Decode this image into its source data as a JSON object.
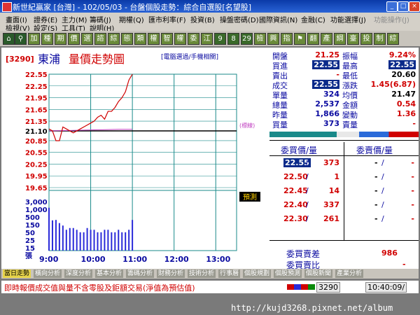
{
  "window": {
    "title": "新世紀贏家 [台灣] - 102/05/03 - 台盤個股走勢：綜合自選股[名望股]"
  },
  "menu": [
    "畫面(I)",
    "證券(E)",
    "主力(M)",
    "籌碼(J)",
    "期權(Q)",
    "匯市利率(F)",
    "投資(B)",
    "操盤密碼(D)",
    "國際資訊(N)",
    "金融(C)",
    "功能選擇(J)",
    "功能操作(J)",
    "檢視(V)",
    "設定(S)",
    "工具(T)",
    "說明(H)"
  ],
  "toolbar": [
    "加",
    "種",
    "期",
    "價",
    "選",
    "諮",
    "綜",
    "態",
    "類",
    "權",
    "智",
    "權",
    "委",
    "江",
    "9",
    "8",
    "29",
    "檢",
    "興",
    "指",
    "⚑",
    "翻",
    "產",
    "綱",
    "臺",
    "投",
    "制",
    "綜"
  ],
  "chart": {
    "code": "[3290]",
    "name": "東浦",
    "title": "量價走勢圖",
    "subtitle": "[電腦選過/手機相關]",
    "y_labels": [
      "22.55",
      "22.25",
      "21.95",
      "21.65",
      "21.35",
      "21.10",
      "20.85",
      "20.55",
      "20.25",
      "19.95",
      "19.65"
    ],
    "ref_price": "21.10",
    "ref_note": "(標線)",
    "vol_labels": [
      "3,000",
      "1,000",
      "500",
      "150",
      "50",
      "25",
      "15",
      "張"
    ],
    "x_labels": [
      "9:00",
      "10:00",
      "11:00",
      "12:00",
      "13:00"
    ],
    "predict_label": "預測"
  },
  "chart_data": {
    "type": "line",
    "title": "量價走勢圖",
    "x_unit": "time",
    "x": [
      "09:00",
      "09:05",
      "09:10",
      "09:15",
      "09:20",
      "09:25",
      "09:30",
      "09:35",
      "09:40",
      "09:45",
      "09:50",
      "09:55",
      "10:00",
      "10:05",
      "10:10",
      "10:15",
      "10:20",
      "10:25",
      "10:30",
      "10:35",
      "10:40",
      "10:45",
      "10:50",
      "10:55",
      "11:00"
    ],
    "series": [
      {
        "values": [
          21.15,
          21.1,
          20.85,
          20.85,
          21.2,
          21.15,
          21.1,
          21.05,
          21.1,
          21.15,
          21.2,
          21.25,
          21.3,
          21.35,
          21.45,
          21.5,
          21.4,
          21.6,
          21.6,
          21.7,
          21.85,
          21.95,
          22.1,
          22.4,
          22.55
        ]
      }
    ],
    "volume": [
      1100,
      140,
      150,
      90,
      60,
      30,
      40,
      40,
      30,
      20,
      20,
      40,
      30,
      30,
      20,
      20,
      30,
      30,
      20,
      20,
      30,
      20,
      20,
      30,
      150
    ],
    "ylim": [
      19.65,
      22.55
    ]
  },
  "quote": {
    "rows": [
      {
        "l1": "開盤",
        "v1": "21.25",
        "l2": "振幅",
        "v2": "9.24%"
      },
      {
        "l1": "買進",
        "v1": "22.55",
        "l2": "最高",
        "v2": "22.55"
      },
      {
        "l1": "賣出",
        "v1": "-",
        "l2": "最低",
        "v2": "20.60"
      },
      {
        "l1": "成交",
        "v1": "22.55",
        "l2": "漲跌",
        "v2": "1.45(6.87)"
      },
      {
        "l1": "單量",
        "v1": "324",
        "l2": "均價",
        "v2": "21.47"
      },
      {
        "l1": "總量",
        "v1": "2,537",
        "l2": "金額",
        "v2": "0.54"
      },
      {
        "l1": "昨量",
        "v1": "1,866",
        "l2": "變動",
        "v2": "1.36"
      },
      {
        "l1": "買量",
        "v1": "373",
        "l2": "賣量",
        "v2": "-"
      }
    ],
    "bid_header": "委買價/量",
    "ask_header": "委賣價/量",
    "book": [
      {
        "bid": "22.55",
        "bq": "373",
        "ask": "-",
        "aq": "-"
      },
      {
        "bid": "22.50",
        "bq": "1",
        "ask": "-",
        "aq": "-"
      },
      {
        "bid": "22.45",
        "bq": "14",
        "ask": "-",
        "aq": "-"
      },
      {
        "bid": "22.40",
        "bq": "337",
        "ask": "-",
        "aq": "-"
      },
      {
        "bid": "22.30",
        "bq": "261",
        "ask": "-",
        "aq": "-"
      }
    ],
    "diff_label": "委買賣差",
    "diff_value": "986",
    "ratio_label": "委買賣比",
    "ratio_value": "-"
  },
  "tabs": [
    "當日走勢",
    "橫向分析",
    "深度分析",
    "基本分析",
    "籌碼分析",
    "財務分析",
    "技術分析",
    "行事曆",
    "個股規劃",
    "個股預測",
    "個股新聞",
    "產業分析"
  ],
  "status": {
    "text": "即時報價成交值與量不含零股及鉅額交易(淨值為預估值)",
    "code": "3290",
    "time": "10:40:09/"
  },
  "url": "http://kujd3268.pixnet.net/album"
}
